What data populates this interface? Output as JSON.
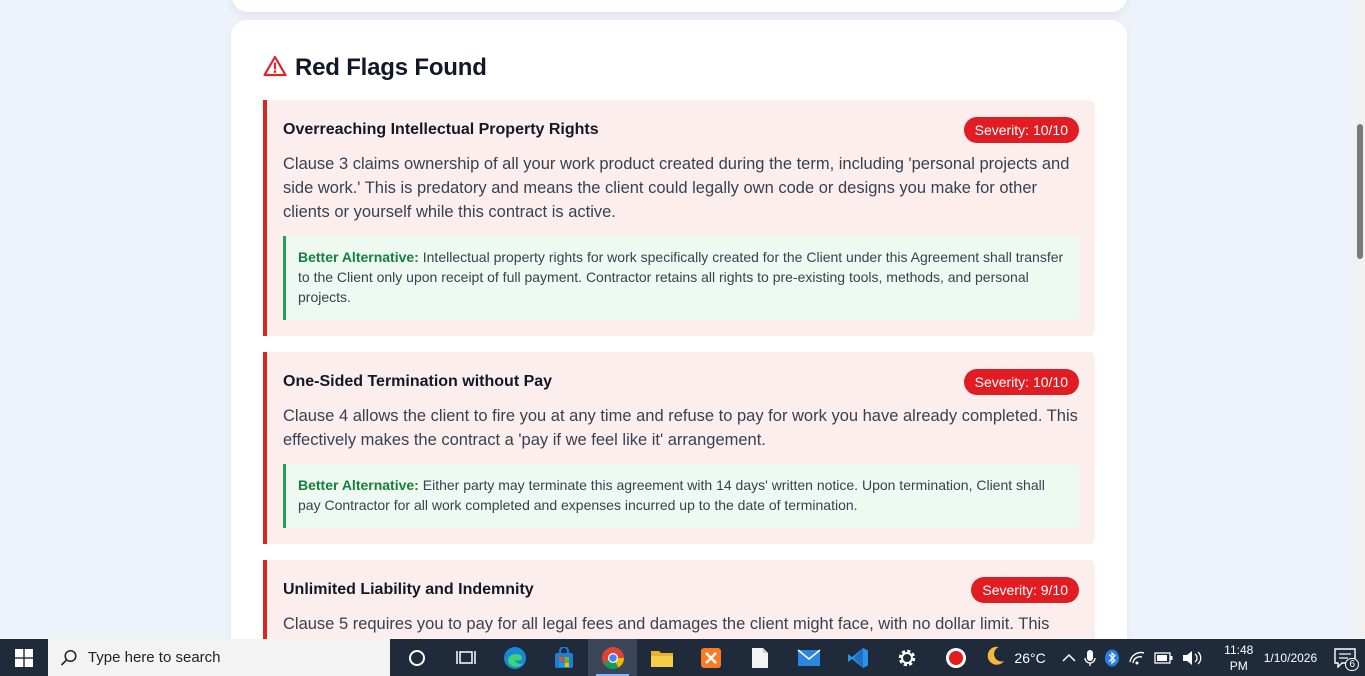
{
  "section": {
    "title": "Red Flags Found",
    "icon": "warning-triangle-icon"
  },
  "flags": [
    {
      "title": "Overreaching Intellectual Property Rights",
      "severity": "Severity: 10/10",
      "description": "Clause 3 claims ownership of all your work product created during the term, including 'personal projects and side work.' This is predatory and means the client could legally own code or designs you make for other clients or yourself while this contract is active.",
      "alt_label": "Better Alternative:",
      "alt_text": "Intellectual property rights for work specifically created for the Client under this Agreement shall transfer to the Client only upon receipt of full payment. Contractor retains all rights to pre-existing tools, methods, and personal projects."
    },
    {
      "title": "One-Sided Termination without Pay",
      "severity": "Severity: 10/10",
      "description": "Clause 4 allows the client to fire you at any time and refuse to pay for work you have already completed. This effectively makes the contract a 'pay if we feel like it' arrangement.",
      "alt_label": "Better Alternative:",
      "alt_text": "Either party may terminate this agreement with 14 days' written notice. Upon termination, Client shall pay Contractor for all work completed and expenses incurred up to the date of termination."
    },
    {
      "title": "Unlimited Liability and Indemnity",
      "severity": "Severity: 9/10",
      "description": "Clause 5 requires you to pay for all legal fees and damages the client might face, with no dollar limit. This"
    }
  ],
  "taskbar": {
    "search_placeholder": "Type here to search",
    "weather": "26°C",
    "time": "11:48 PM",
    "date": "1/10/2026",
    "notification_count": "6",
    "apps": [
      "cortana-icon",
      "task-view-icon",
      "edge-icon",
      "store-icon",
      "chrome-icon",
      "file-explorer-icon",
      "xampp-icon",
      "notepad-icon",
      "mail-icon",
      "vscode-icon",
      "settings-icon",
      "recorder-icon"
    ]
  },
  "colors": {
    "flag_border": "#dc2626",
    "flag_bg": "#fdeeee",
    "badge": "#e11d24",
    "alt_border": "#22a355",
    "alt_label": "#15803d"
  }
}
